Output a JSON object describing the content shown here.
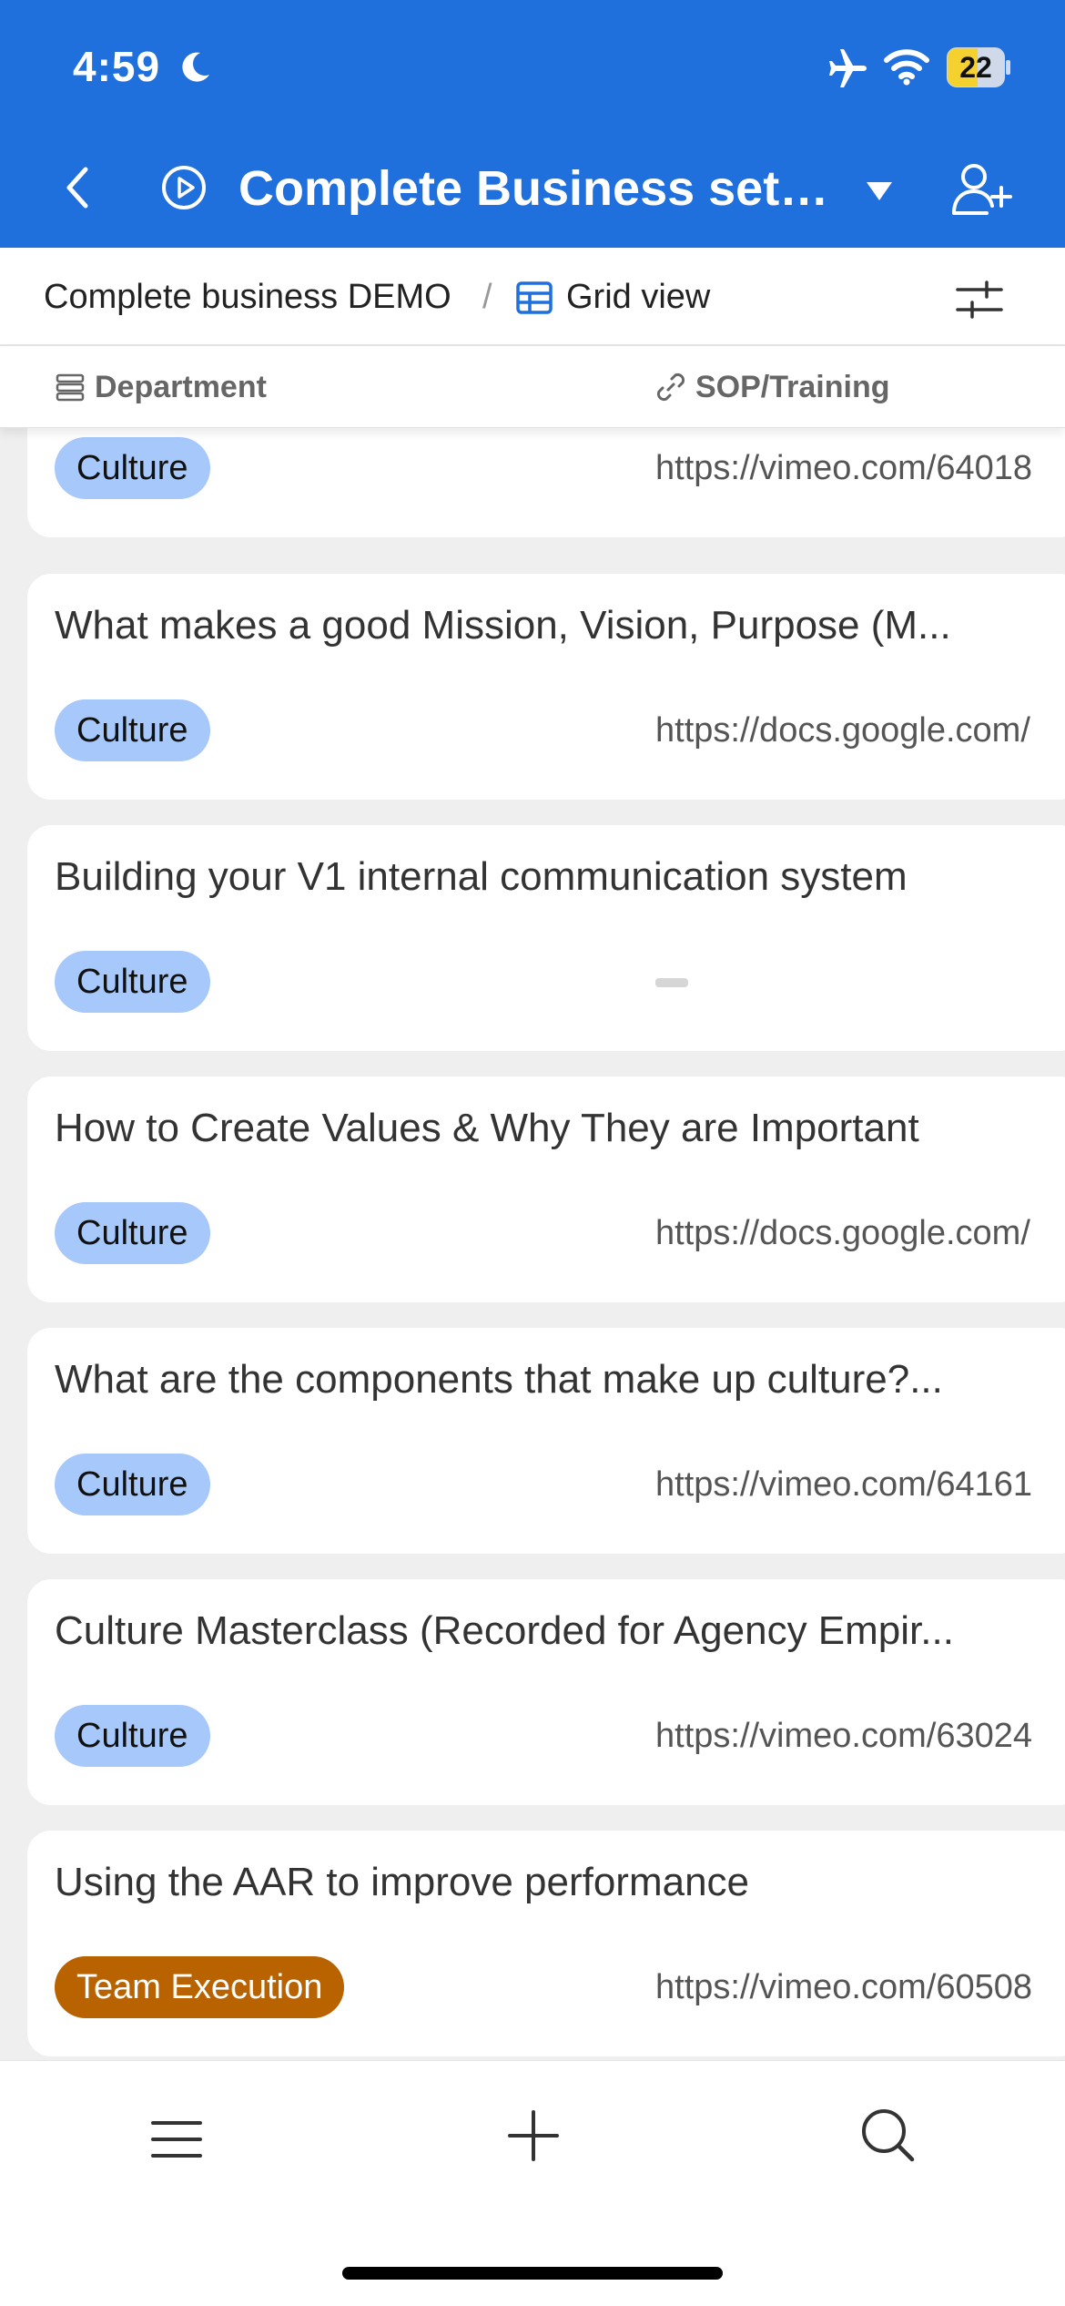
{
  "status_bar": {
    "time": "4:59",
    "battery": "22",
    "icons": [
      "moon-icon",
      "airplane-icon",
      "wifi-icon",
      "battery-icon"
    ]
  },
  "header": {
    "title": "Complete Business setu...",
    "icons": [
      "back-icon",
      "play-circle-icon",
      "caret-down-icon",
      "add-user-icon"
    ]
  },
  "subheader": {
    "base_name": "Complete business DEMO",
    "separator": "/",
    "view_name": "Grid view",
    "icons": [
      "grid-view-icon",
      "filter-sliders-icon"
    ]
  },
  "columns": [
    {
      "label": "Department",
      "icon": "single-select-icon"
    },
    {
      "label": "SOP/Training",
      "icon": "link-icon"
    }
  ],
  "records": [
    {
      "title": "",
      "department": "Culture",
      "sop": "https://vimeo.com/64018"
    },
    {
      "title": "What makes a good Mission, Vision, Purpose (M...",
      "department": "Culture",
      "sop": "https://docs.google.com/"
    },
    {
      "title": "Building your V1 internal communication system",
      "department": "Culture",
      "sop": ""
    },
    {
      "title": "How to Create Values & Why They are Important",
      "department": "Culture",
      "sop": "https://docs.google.com/"
    },
    {
      "title": "What are the components that make up culture?...",
      "department": "Culture",
      "sop": "https://vimeo.com/64161"
    },
    {
      "title": " Culture Masterclass (Recorded for Agency Empir...",
      "department": "Culture",
      "sop": "https://vimeo.com/63024"
    },
    {
      "title": "Using the AAR to improve performance",
      "department": "Team Execution",
      "sop": "https://vimeo.com/60508"
    }
  ],
  "bottom_bar": {
    "icons": [
      "menu-icon",
      "plus-icon",
      "search-icon"
    ]
  },
  "colors": {
    "header_blue": "#1f6fdc",
    "culture_tag": "#a6c8fb",
    "team_execution_tag": "#b86300",
    "battery_yellow": "#f5d130"
  }
}
